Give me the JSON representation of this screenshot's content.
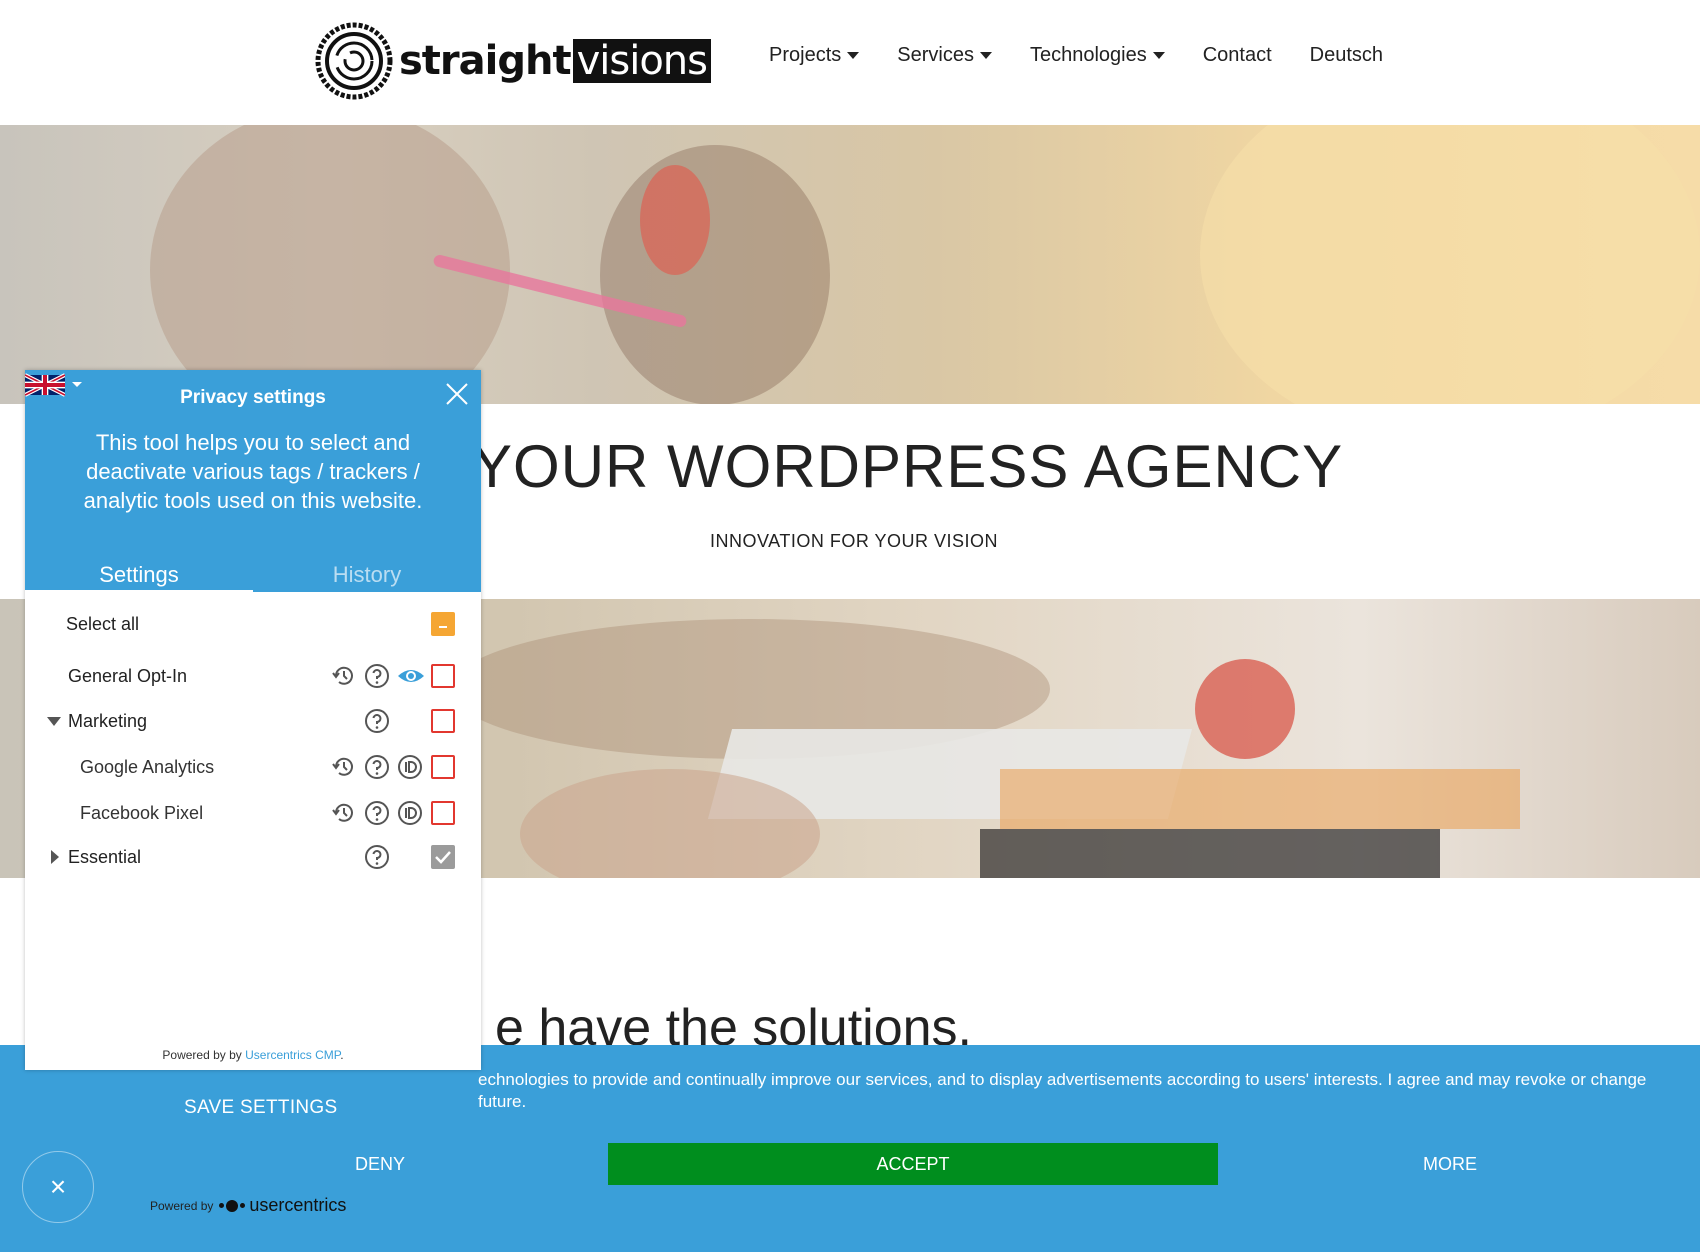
{
  "site": {
    "logo_bold": "straight",
    "logo_boxed": "visions",
    "nav": [
      {
        "label": "Projects",
        "has_dropdown": true
      },
      {
        "label": "Services",
        "has_dropdown": true
      },
      {
        "label": "Technologies",
        "has_dropdown": true
      },
      {
        "label": "Contact",
        "has_dropdown": false
      },
      {
        "label": "Deutsch",
        "has_dropdown": false
      }
    ],
    "hero_title": "YOUR WORDPRESS AGENCY",
    "hero_subtitle": "INNOVATION FOR YOUR VISION",
    "solutions_heading": "e have the solutions."
  },
  "consent_bar": {
    "text": "echnologies to provide and continually improve our services, and to display advertisements according to users' interests. I agree and may revoke or change future.",
    "save_settings": "SAVE SETTINGS",
    "deny": "DENY",
    "accept": "ACCEPT",
    "more": "MORE",
    "close_symbol": "×",
    "powered_by": "Powered by",
    "powered_brand": "usercentrics",
    "color_bar": "#3a9fd9",
    "color_accept": "#008e1e"
  },
  "privacy_panel": {
    "language_flag": "uk-flag-icon",
    "title": "Privacy settings",
    "description": "This tool helps you to select and deactivate various tags / trackers / analytic tools used on this website.",
    "tabs": [
      {
        "label": "Settings",
        "active": true
      },
      {
        "label": "History",
        "active": false
      }
    ],
    "select_all": "Select all",
    "rows": [
      {
        "label": "General Opt-In",
        "icons": [
          "history-icon",
          "help-icon",
          "eye-icon"
        ],
        "checked": false
      },
      {
        "label": "Marketing",
        "expanded": true,
        "icons": [
          "help-icon"
        ],
        "checked": false
      },
      {
        "label": "Google Analytics",
        "icons": [
          "history-icon",
          "help-icon",
          "id-icon"
        ],
        "checked": false
      },
      {
        "label": "Facebook Pixel",
        "icons": [
          "history-icon",
          "help-icon",
          "id-icon"
        ],
        "checked": false
      },
      {
        "label": "Essential",
        "expanded": false,
        "icons": [
          "help-icon"
        ],
        "checked": true,
        "locked": true
      }
    ],
    "footer_prefix": "Powered by by ",
    "footer_link": "Usercentrics CMP",
    "footer_suffix": "."
  }
}
